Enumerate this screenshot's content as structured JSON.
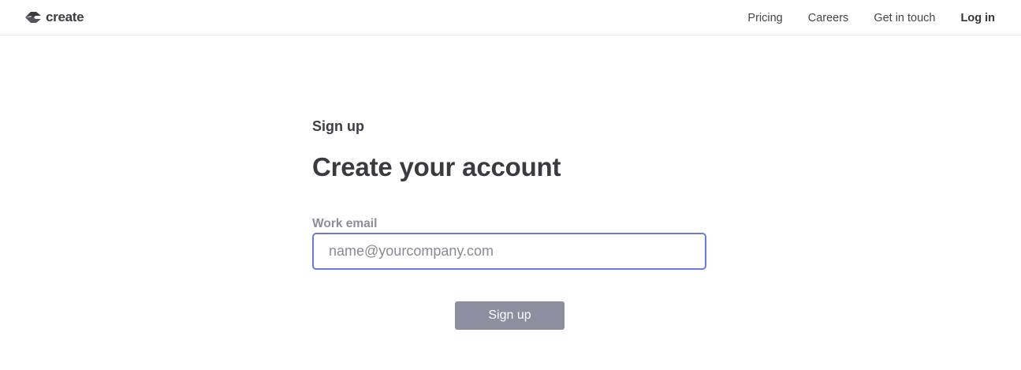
{
  "header": {
    "logo": {
      "icon": "create-logo-icon",
      "text": "create"
    },
    "nav": {
      "pricing": "Pricing",
      "careers": "Careers",
      "contact": "Get in touch",
      "login": "Log in"
    }
  },
  "form": {
    "eyebrow": "Sign up",
    "title": "Create your account",
    "email_label": "Work email",
    "email_value": "",
    "email_placeholder": "name@yourcompany.com",
    "submit_label": "Sign up"
  },
  "colors": {
    "input_focus_border": "#6b78e0",
    "button_bg": "#8d8ea0",
    "label_text": "#8c8c9c"
  }
}
